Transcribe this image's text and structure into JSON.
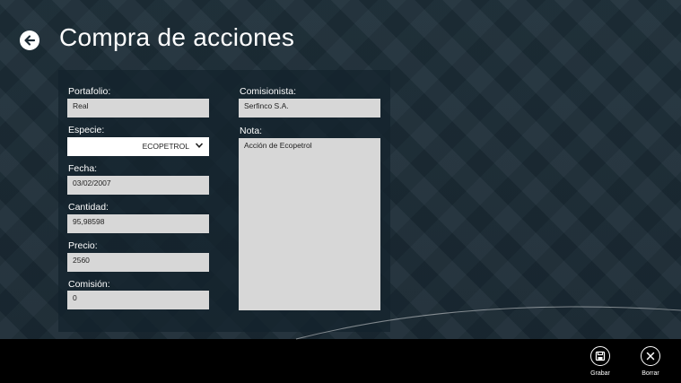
{
  "page": {
    "title": "Compra de acciones"
  },
  "form": {
    "portafolio": {
      "label": "Portafolio:",
      "value": "Real"
    },
    "especie": {
      "label": "Especie:",
      "value": "ECOPETROL"
    },
    "fecha": {
      "label": "Fecha:",
      "value": "03/02/2007"
    },
    "cantidad": {
      "label": "Cantidad:",
      "value": "95,98598"
    },
    "precio": {
      "label": "Precio:",
      "value": "2560"
    },
    "comision": {
      "label": "Comisión:",
      "value": "0"
    },
    "comisionista": {
      "label": "Comisionista:",
      "value": "Serfinco S.A."
    },
    "nota": {
      "label": "Nota:",
      "value": "Acción de Ecopetrol"
    }
  },
  "appbar": {
    "buttons": [
      {
        "label": "Grabar",
        "icon": "save-icon"
      },
      {
        "label": "Borrar",
        "icon": "close-icon"
      }
    ]
  },
  "colors": {
    "background": "#1b2a34",
    "field": "#d7d7d7",
    "appbar": "#000000"
  }
}
